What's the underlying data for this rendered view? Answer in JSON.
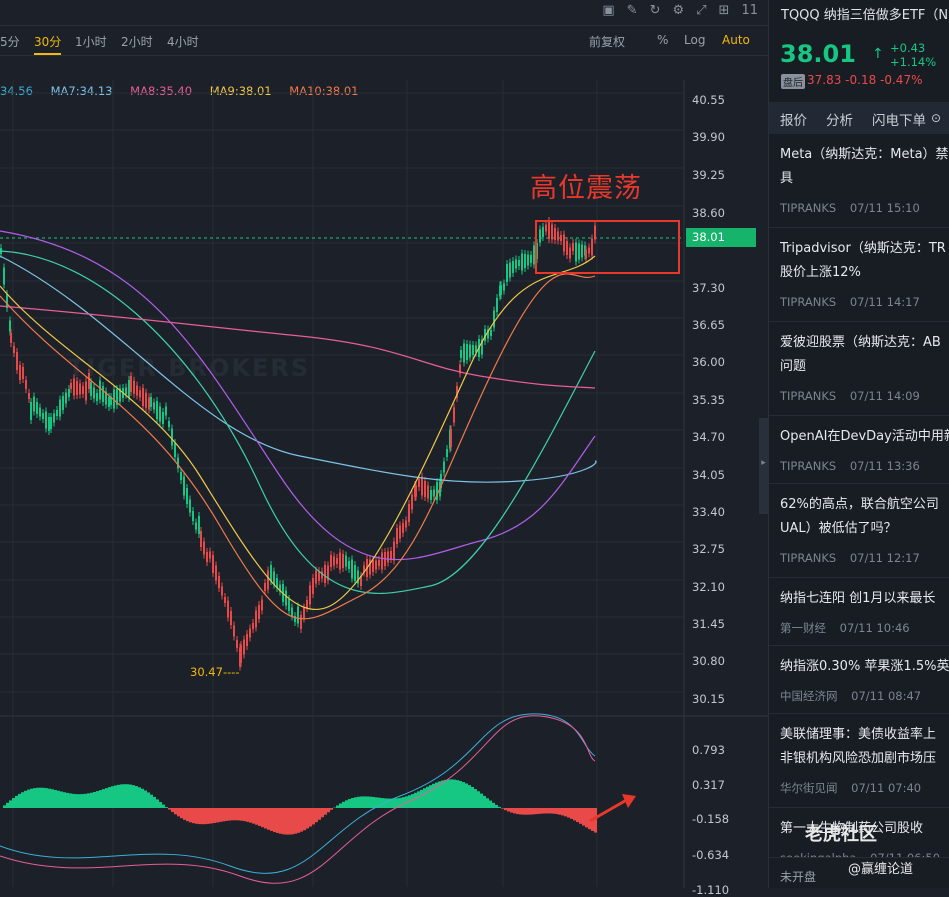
{
  "toolbar": {
    "icons": [
      "chart-icon",
      "draw-icon",
      "refresh-icon",
      "settings-icon",
      "fullscreen-icon",
      "layout-icon"
    ],
    "count": "11"
  },
  "periods": [
    "5分",
    "30分",
    "1小时",
    "2小时",
    "4小时"
  ],
  "active_period": "30分",
  "controls": {
    "adjust": "前复权",
    "percent": "%",
    "log": "Log",
    "auto": "Auto"
  },
  "ma": [
    {
      "label": "34.56",
      "color": "#3db0d8"
    },
    {
      "label": "MA7:34.13",
      "color": "#7ec3e8"
    },
    {
      "label": "MA8:35.40",
      "color": "#e85d9a"
    },
    {
      "label": "MA9:38.01",
      "color": "#f0c84a"
    },
    {
      "label": "MA10:38.01",
      "color": "#f07a4a"
    }
  ],
  "price_ticks": [
    "40.55",
    "39.90",
    "39.25",
    "38.60",
    "37.30",
    "36.65",
    "36.00",
    "35.35",
    "34.70",
    "34.05",
    "33.40",
    "32.75",
    "32.10",
    "31.45",
    "30.80",
    "30.15"
  ],
  "current_price_label": "38.01",
  "macd_ticks": [
    "0.793",
    "0.317",
    "-0.158",
    "-0.634",
    "-1.110"
  ],
  "annotation": "高位震荡",
  "low_label": "30.47",
  "watermark": "TIGER BROKERS",
  "side": {
    "symbol": "TQQQ 纳指三倍做多ETF（N",
    "price": "38.01",
    "change": "+0.43",
    "change_pct": "+1.14%",
    "ah_badge": "盘后",
    "ah_text": "37.83 -0.18 -0.47%",
    "tabs": [
      "报价",
      "分析",
      "闪电下单"
    ],
    "news": [
      {
        "title": "Meta（纳斯达克：Meta）禁\n具",
        "source": "TIPRANKS",
        "time": "07/11 15:10"
      },
      {
        "title": "Tripadvisor（纳斯达克：TR\n股价上涨12%",
        "source": "TIPRANKS",
        "time": "07/11 14:17"
      },
      {
        "title": "爱彼迎股票（纳斯达克：AB\n问题",
        "source": "TIPRANKS",
        "time": "07/11 14:09"
      },
      {
        "title": "OpenAI在DevDay活动中用新",
        "source": "TIPRANKS",
        "time": "07/11 13:36"
      },
      {
        "title": "62%的高点，联合航空公司\nUAL）被低估了吗？",
        "source": "TIPRANKS",
        "time": "07/11 12:17"
      },
      {
        "title": "纳指七连阳 创1月以来最长",
        "source": "第一财经",
        "time": "07/11 10:46"
      },
      {
        "title": "纳指涨0.30% 苹果涨1.5%英",
        "source": "中国经济网",
        "time": "07/11 08:47"
      },
      {
        "title": "美联储理事：美债收益率上\n非银机构风险恐加剧市场压",
        "source": "华尔街见闻",
        "time": "07/11 07:40"
      },
      {
        "title": "第一大生物制药公司股收",
        "source": "seekingalpha",
        "time": "07/11 06:50"
      }
    ],
    "market_status": "未开盘",
    "watermark_a": "老虎社区",
    "watermark_b": "@赢缠论道"
  }
}
